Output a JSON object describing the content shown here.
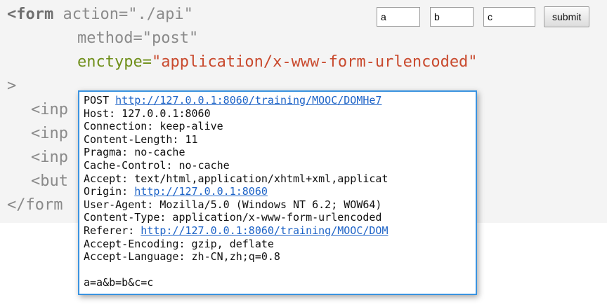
{
  "code": {
    "line1_tag": "<form",
    "line1_attr": " action=\"./api\"",
    "line2": "method=\"post\"",
    "line3_attr": "enctype=",
    "line3_value": "\"application/x-www-form-urlencoded\"",
    "line4": ">",
    "line5": "<inp",
    "line6": "<inp",
    "line7": "<inp",
    "line8": "<but",
    "line9": "</form"
  },
  "demo_form": {
    "field_a": "a",
    "field_b": "b",
    "field_c": "c",
    "submit_label": "submit"
  },
  "request": {
    "method": "POST",
    "url": "http://127.0.0.1:8060/training/MOOC/DOMHe7",
    "host": "Host: 127.0.0.1:8060",
    "connection": "Connection: keep-alive",
    "content_length": "Content-Length: 11",
    "pragma": "Pragma: no-cache",
    "cache_control": "Cache-Control: no-cache",
    "accept": "Accept: text/html,application/xhtml+xml,applicat",
    "origin_label": "Origin:",
    "origin_url": "http://127.0.0.1:8060",
    "user_agent": "User-Agent: Mozilla/5.0 (Windows NT 6.2; WOW64)",
    "content_type": "Content-Type: application/x-www-form-urlencoded",
    "referer_label": "Referer:",
    "referer_url": "http://127.0.0.1:8060/training/MOOC/DOM",
    "accept_encoding": "Accept-Encoding: gzip, deflate",
    "accept_language": "Accept-Language: zh-CN,zh;q=0.8",
    "body": "a=a&b=b&c=c"
  },
  "colors": {
    "accent_attr": "#6f8f1a",
    "accent_string": "#c94a2e",
    "popup_border": "#3a93e0",
    "link": "#1d63c7"
  }
}
